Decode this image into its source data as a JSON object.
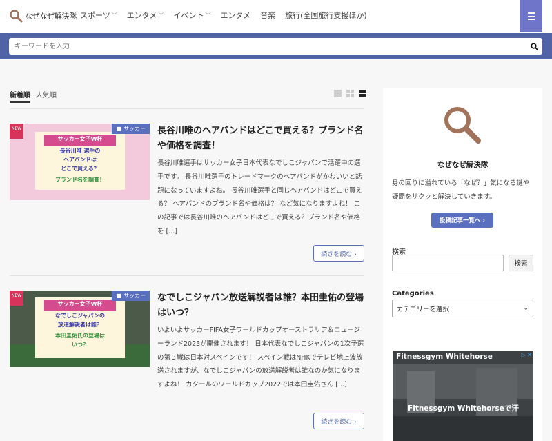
{
  "header": {
    "logo_text": "なぜなぜ解決隊",
    "nav": [
      {
        "label": "スポーツ",
        "has_dropdown": true
      },
      {
        "label": "エンタメ",
        "has_dropdown": true
      },
      {
        "label": "イベント",
        "has_dropdown": true
      },
      {
        "label": "エンタメ",
        "has_dropdown": false
      },
      {
        "label": "音楽",
        "has_dropdown": false
      },
      {
        "label": "旅行(全国旅行支援ほか)",
        "has_dropdown": false
      }
    ],
    "menu_icon": "hamburger-icon"
  },
  "search": {
    "placeholder": "キーワードを入力",
    "icon": "search-icon"
  },
  "sort": {
    "tabs": [
      "新着順",
      "人気順"
    ],
    "active": "新着順"
  },
  "posts": [
    {
      "title": "長谷川唯のヘアバンドはどこで買える？ブランド名や価格を調査！",
      "category": "サッカー",
      "new_tag": "NEW",
      "excerpt": "長谷川唯選手はサッカー女子日本代表なでしこジャパンで活躍中の選手です。 長谷川唯選手のトレードマークのヘアバンドがかわいいと話題になっていますよね。 長谷川唯選手と同じヘアバンドはどこで買える？ ヘアバンドのブランド名や価格は？ など気になりますよね！ この記事では長谷川唯のヘアバンドはどこで買える？ブランド名や価格を [...]",
      "more_label": "続きを読む ›",
      "thumb_lines": [
        "サッカー女子W杯",
        "長谷川唯 選手の",
        "ヘアバンドは",
        "どこで買える？",
        "ブランド名を調査！"
      ]
    },
    {
      "title": "なでしこジャパン放送解説者は誰？本田圭佑の登場はいつ？",
      "category": "サッカー",
      "new_tag": "NEW",
      "excerpt": "いよいよサッカーFIFA女子ワールドカップオーストラリア＆ニュージーランド2023が開催されます！ 日本代表なでしこジャパンの1次予選の第３戦は日本対スペインです！ スペイン戦はNHKでテレビ地上波放送されますが、なでしこジャパンの放送解説者は誰なのか気になりますよね！ カタールのワールドカップ2022では本田圭佑さん [...]",
      "more_label": "続きを読む ›",
      "thumb_lines": [
        "サッカー女子W杯",
        "なでしこジャパンの",
        "放送解説者は誰？",
        "本田圭佑氏の登場は",
        "いつ？"
      ]
    }
  ],
  "sidebar": {
    "title": "なぜなぜ解決隊",
    "description": "身の回りに溢れている「なぜ？」気になる謎や疑問をサクッと解決していきます。",
    "list_button": "投稿記事一覧へ ›",
    "search_label": "検索",
    "search_button": "検索",
    "categories_label": "Categories",
    "categories_select": "カテゴリーを選択",
    "ad_title": "Fitnessgym Whitehorse",
    "ad_overlay": "Fitnessgym Whitehorseで汗"
  },
  "colors": {
    "accent": "#5b6fbf",
    "search_band": "#4f63a6",
    "menu_button": "#6f76c9",
    "logo_icon": "#a0735a"
  }
}
